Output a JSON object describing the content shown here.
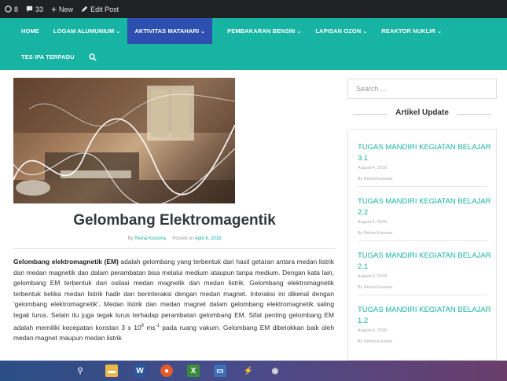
{
  "adminbar": {
    "comments_count": "8",
    "updates_count": "33",
    "new_label": "New",
    "edit_label": "Edit Post"
  },
  "nav": {
    "row1": [
      {
        "label": "HOME",
        "dropdown": false,
        "active": false
      },
      {
        "label": "LOGAM ALUMUNIUM",
        "dropdown": true,
        "active": false
      },
      {
        "label": "AKTIVITAS MATAHARI",
        "dropdown": true,
        "active": true
      },
      {
        "label": "PEMBAKARAN BENSIN",
        "dropdown": true,
        "active": false
      },
      {
        "label": "LAPISAN OZON",
        "dropdown": true,
        "active": false
      },
      {
        "label": "REAKTOR NUKLIR",
        "dropdown": true,
        "active": false
      }
    ],
    "row2": [
      {
        "label": "TES IPA TERPADU",
        "dropdown": false,
        "active": false
      }
    ]
  },
  "post": {
    "title": "Gelombang Elektromagentik",
    "by": "By",
    "author": "Retna Kusuma",
    "posted_on": "Posted on",
    "date": "April 6, 2018",
    "term": "Gelombang elektromagnetik (EM)",
    "text_rest": " adalah gelombang yang terbentuk dari hasil getaran antara medan listrik dan medan magnetik dan dalam perambatan bisa melalui medium ataupun tanpa medium. Dengan kata lain, gelombang EM terbentuk dari osilasi medan magnetik dan medan listrik. Gelombang elektromagnetik terbentuk ketika medan listrik hadir dan berinteraksi dengan medan magnet. Interaksi ini dikenal dengan 'gelombang elektromagnetik'. Medan listrik dan medan magnet dalam gelombang elektromagnetik saling tegak lurus. Selain itu juga tegak lurus terhadap perambatan gelombang EM. Sifat penting gelombang EM adalah memiliki kecepatan konstan 3 x 10",
    "sup1": "8",
    "text_unit": " ms",
    "sup2": "-1",
    "text_tail": " pada ruang vakum. Gelombang EM dibelokkan baik oleh medan magnet maupun medan listrik"
  },
  "sidebar": {
    "search_placeholder": "Search ...",
    "widget_title": "Artikel Update",
    "articles": [
      {
        "title": "TUGAS MANDIRI KEGIATAN BELAJAR 3.1",
        "date": "August 4, 2018",
        "by": "By Retna Kusuma"
      },
      {
        "title": "TUGAS MANDIRI KEGIATAN BELAJAR 2.2",
        "date": "August 4, 2018",
        "by": "By Retna Kusuma"
      },
      {
        "title": "TUGAS MANDIRI KEGIATAN BELAJAR 2.1",
        "date": "August 4, 2018",
        "by": "By Retna Kusuma"
      },
      {
        "title": "TUGAS MANDIRI KEGIATAN BELAJAR 1.2",
        "date": "August 4, 2018",
        "by": "By Retna Kusuma"
      }
    ]
  },
  "colors": {
    "nav_bg": "#17b3a3",
    "nav_active": "#2c4fb0",
    "accent": "#17b3a3",
    "adminbar_bg": "#1f2124"
  }
}
